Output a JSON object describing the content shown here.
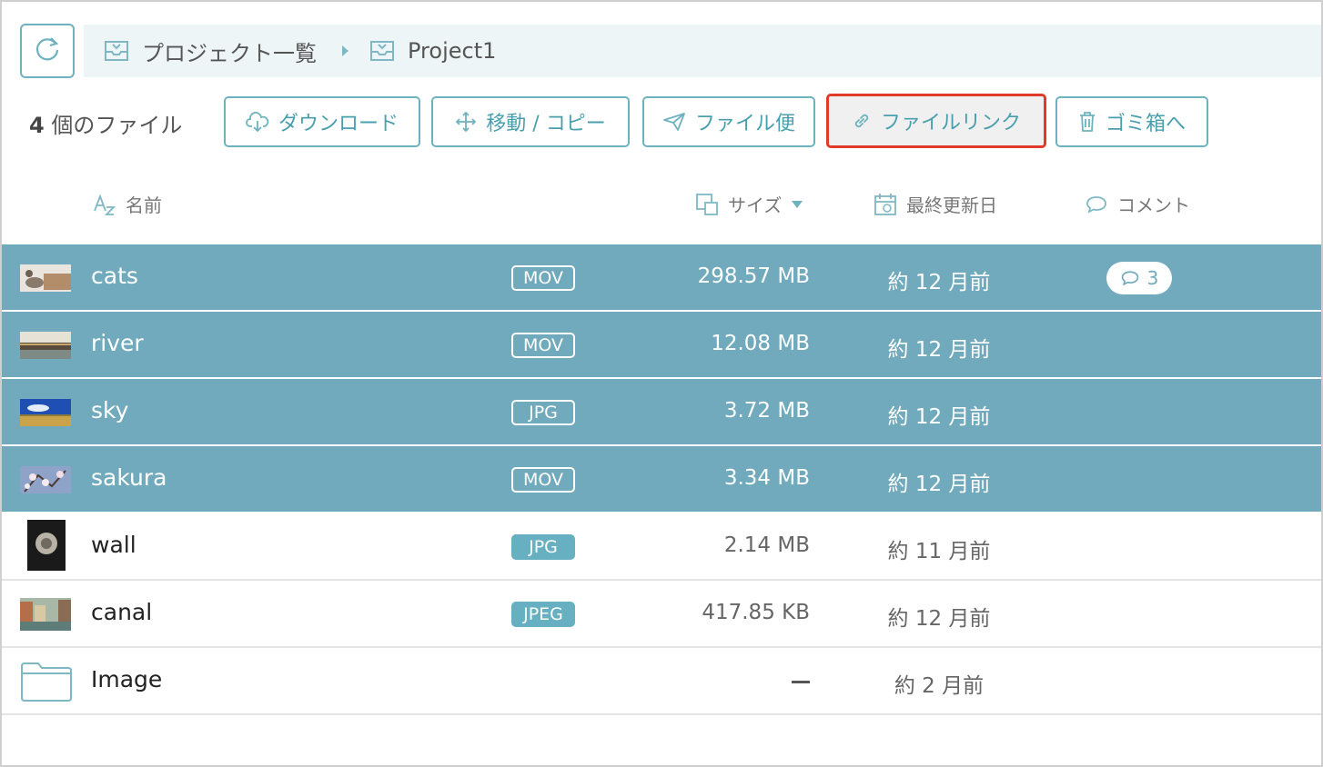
{
  "breadcrumb": {
    "items": [
      {
        "label": "プロジェクト一覧",
        "icon": "project-box-icon"
      },
      {
        "label": "Project1",
        "icon": "project-box-icon"
      }
    ],
    "separator_icon": "caret-right-icon",
    "refresh_icon": "refresh-icon"
  },
  "toolbar": {
    "count_number": "4",
    "count_suffix": " 個のファイル",
    "buttons": [
      {
        "label": "ダウンロード",
        "icon": "cloud-download-icon"
      },
      {
        "label": "移動 / コピー",
        "icon": "move-arrows-icon"
      },
      {
        "label": "ファイル便",
        "icon": "paper-plane-icon"
      },
      {
        "label": "ファイルリンク",
        "icon": "link-icon",
        "highlighted": true
      },
      {
        "label": "ゴミ箱へ",
        "icon": "trash-icon"
      }
    ]
  },
  "columns": {
    "name": "名前",
    "size": "サイズ",
    "updated": "最終更新日",
    "comment": "コメント"
  },
  "files": [
    {
      "name": "cats",
      "type": "MOV",
      "size": "298.57 MB",
      "updated": "約 12 月前",
      "comments": "3",
      "selected": true
    },
    {
      "name": "river",
      "type": "MOV",
      "size": "12.08 MB",
      "updated": "約 12 月前",
      "selected": true
    },
    {
      "name": "sky",
      "type": "JPG",
      "size": "3.72 MB",
      "updated": "約 12 月前",
      "selected": true
    },
    {
      "name": "sakura",
      "type": "MOV",
      "size": "3.34 MB",
      "updated": "約 12 月前",
      "selected": true
    },
    {
      "name": "wall",
      "type": "JPG",
      "size": "2.14 MB",
      "updated": "約 11 月前",
      "selected": false
    },
    {
      "name": "canal",
      "type": "JPEG",
      "size": "417.85 KB",
      "updated": "約 12 月前",
      "selected": false
    },
    {
      "name": "Image",
      "type": "",
      "size": "",
      "updated": "約 2 月前",
      "selected": false,
      "is_folder": true
    }
  ],
  "colors": {
    "accent": "#6fb2bf",
    "selected_row": "#70aabc",
    "highlight_border": "#e23a28"
  }
}
